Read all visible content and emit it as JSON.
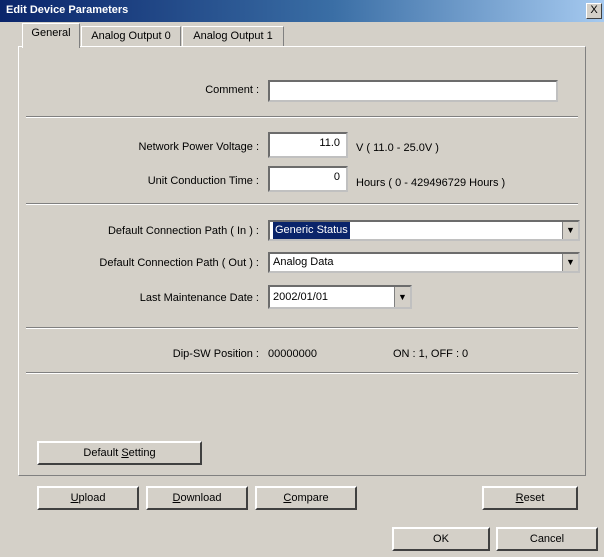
{
  "window": {
    "title": "Edit Device Parameters",
    "close_glyph": "X"
  },
  "tabs": [
    {
      "label": "General"
    },
    {
      "label": "Analog Output 0"
    },
    {
      "label": "Analog Output 1"
    }
  ],
  "general": {
    "comment_label": "Comment :",
    "comment_value": "",
    "voltage_label": "Network Power Voltage :",
    "voltage_value": "11.0",
    "voltage_unit": "V ( 11.0 - 25.0V )",
    "uct_label": "Unit Conduction Time :",
    "uct_value": "0",
    "uct_unit": "Hours ( 0 - 429496729 Hours )",
    "path_in_label": "Default Connection Path ( In ) :",
    "path_in_value": "Generic Status",
    "path_out_label": "Default Connection Path ( Out ) :",
    "path_out_value": "Analog Data",
    "maint_label": "Last Maintenance Date :",
    "maint_value": "2002/01/01",
    "dip_label": "Dip-SW Position :",
    "dip_value": "00000000",
    "dip_note": "ON : 1, OFF : 0",
    "default_setting": {
      "pre": "Default ",
      "mn": "S",
      "post": "etting"
    }
  },
  "buttons": {
    "upload": {
      "pre": "",
      "mn": "U",
      "post": "pload"
    },
    "download": {
      "pre": "",
      "mn": "D",
      "post": "ownload"
    },
    "compare": {
      "pre": "",
      "mn": "C",
      "post": "ompare"
    },
    "reset": {
      "pre": "",
      "mn": "R",
      "post": "eset"
    },
    "ok": "OK",
    "cancel": "Cancel"
  },
  "icons": {
    "dropdown": "chevron-down-icon"
  }
}
